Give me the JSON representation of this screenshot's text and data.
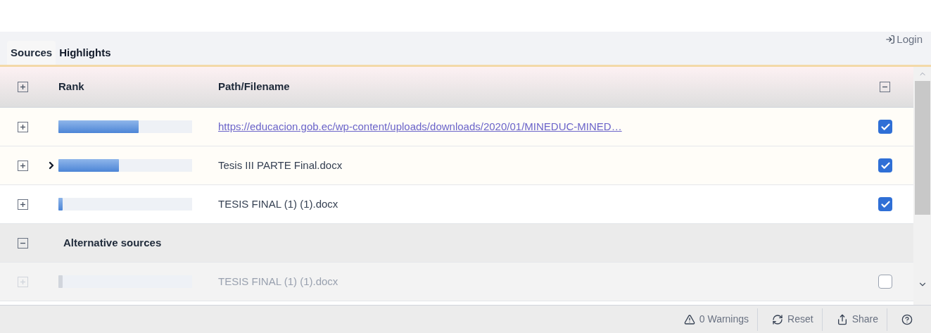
{
  "tabs": [
    {
      "label": "Sources",
      "selected": true
    },
    {
      "label": "Highlights",
      "selected": false
    }
  ],
  "login": {
    "label": "Login"
  },
  "table": {
    "columns": [
      "Rank",
      "Path/Filename"
    ],
    "rows": [
      {
        "kind": "link",
        "level": 0.6,
        "path": "https://educacion.gob.ec/wp-content/uploads/downloads/2020/01/MINEDUC-MINED…",
        "checked": true,
        "has_children": false,
        "disabled": false
      },
      {
        "kind": "text",
        "level": 0.45,
        "path": "Tesis III PARTE Final.docx",
        "checked": true,
        "has_children": true,
        "disabled": false
      },
      {
        "kind": "text",
        "level": 0.03,
        "path": "TESIS FINAL (1) (1).docx",
        "checked": true,
        "has_children": false,
        "disabled": false
      }
    ],
    "group": {
      "label": "Alternative sources",
      "expanded": true,
      "rows": [
        {
          "kind": "text",
          "level": 0.03,
          "path": "TESIS FINAL (1) (1).docx",
          "checked": false,
          "has_children": false,
          "disabled": true
        }
      ]
    }
  },
  "footer": {
    "buttons": [
      {
        "kind": "warning",
        "label": "0 Warnings"
      },
      {
        "kind": "reset",
        "label": "Reset"
      },
      {
        "kind": "share",
        "label": "Share"
      },
      {
        "kind": "help"
      }
    ]
  }
}
